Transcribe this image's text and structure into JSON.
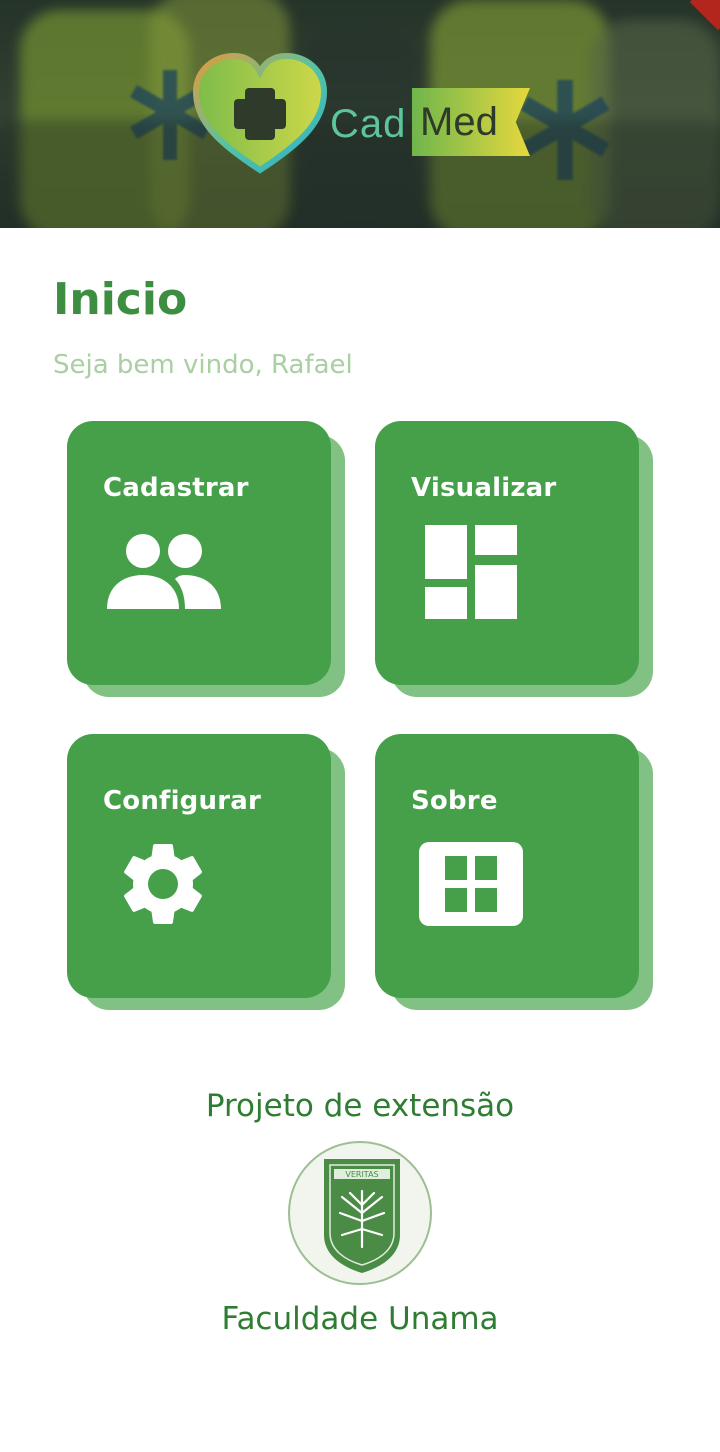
{
  "app": {
    "name_part1": "Cad",
    "name_part2": "Med"
  },
  "header": {
    "title": "Inicio",
    "welcome": "Seja bem vindo, Rafael"
  },
  "tiles": [
    {
      "label": "Cadastrar",
      "icon": "people-icon"
    },
    {
      "label": "Visualizar",
      "icon": "dashboard-icon"
    },
    {
      "label": "Configurar",
      "icon": "gear-icon"
    },
    {
      "label": "Sobre",
      "icon": "grid-box-icon"
    }
  ],
  "footer": {
    "project": "Projeto de extensão",
    "faculty": "Faculdade Unama",
    "seal_text": "VERITAS"
  },
  "colors": {
    "primary": "#45a049",
    "tile_shadow": "#81c184",
    "title": "#3e8e41",
    "subtitle": "#a9cfa3"
  }
}
